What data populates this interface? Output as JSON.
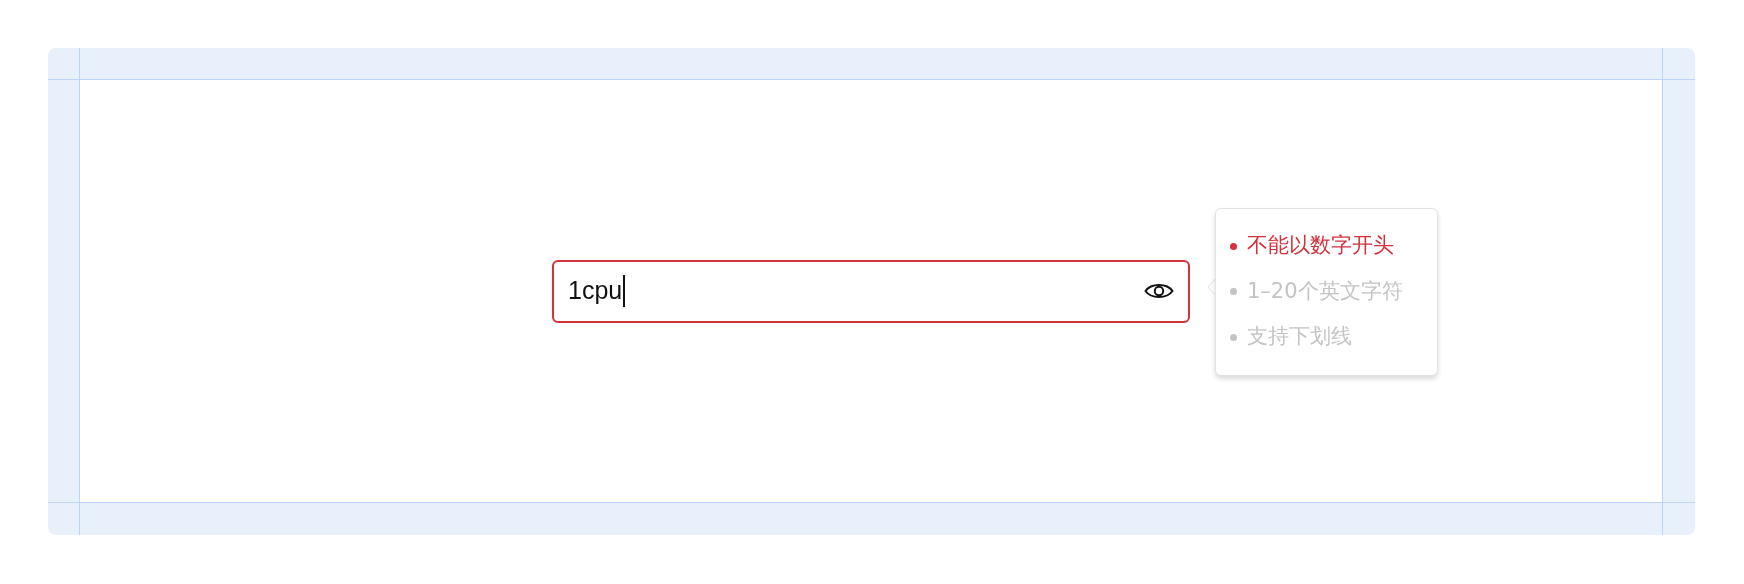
{
  "password_field": {
    "value": "1cpu",
    "error": true,
    "focused": true
  },
  "rules_tooltip": {
    "rules": [
      {
        "text": "不能以数字开头",
        "error": true
      },
      {
        "text": "1–20个英文字符",
        "error": false
      },
      {
        "text": "支持下划线",
        "error": false
      }
    ]
  }
}
